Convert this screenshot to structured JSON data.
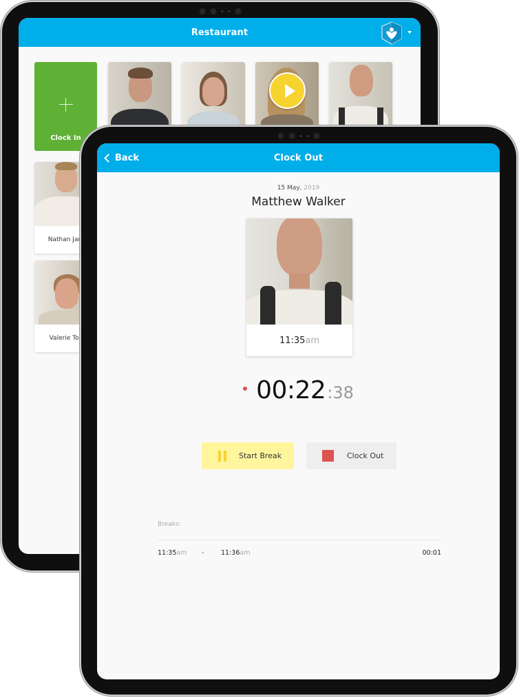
{
  "back_device": {
    "nav": {
      "title": "Restaurant",
      "brand_icon": "shield-heart-logo",
      "menu_icon": "caret-down"
    },
    "clock_in_tile": {
      "label": "Clock In",
      "icon": "plus"
    },
    "employees": [
      {
        "name": "",
        "photo": "man-dark-tshirt"
      },
      {
        "name": "",
        "photo": "woman-smiling"
      },
      {
        "name": "",
        "photo": "woman-blonde",
        "overlay_icon": "play"
      },
      {
        "name": "",
        "photo": "man-backpack"
      },
      {
        "name": "Nathan Jam",
        "photo": "man-white-shirt"
      },
      {
        "name": "Valerie Tod",
        "photo": "woman-hair-up"
      }
    ]
  },
  "front_device": {
    "nav": {
      "back_label": "Back",
      "title": "Clock Out"
    },
    "date": {
      "day_month": "15 May,",
      "year": "2019"
    },
    "employee_name": "Matthew Walker",
    "clock_in_time": {
      "time": "11:35",
      "ampm": "am"
    },
    "timer": {
      "main": "00:22",
      "seconds": ":38"
    },
    "buttons": {
      "start_break": "Start Break",
      "clock_out": "Clock Out"
    },
    "breaks": {
      "label": "Breaks:",
      "rows": [
        {
          "start": "11:35",
          "start_ampm": "am",
          "separator": "-",
          "end": "11:36",
          "end_ampm": "am",
          "duration": "00:01"
        }
      ]
    }
  },
  "colors": {
    "nav_blue": "#00aeea",
    "clock_in_green": "#5eb135",
    "break_yellow": "#fff59d",
    "pause_yellow": "#f7d330",
    "stop_red": "#dd5450",
    "rec_dot_red": "#d9534f"
  }
}
